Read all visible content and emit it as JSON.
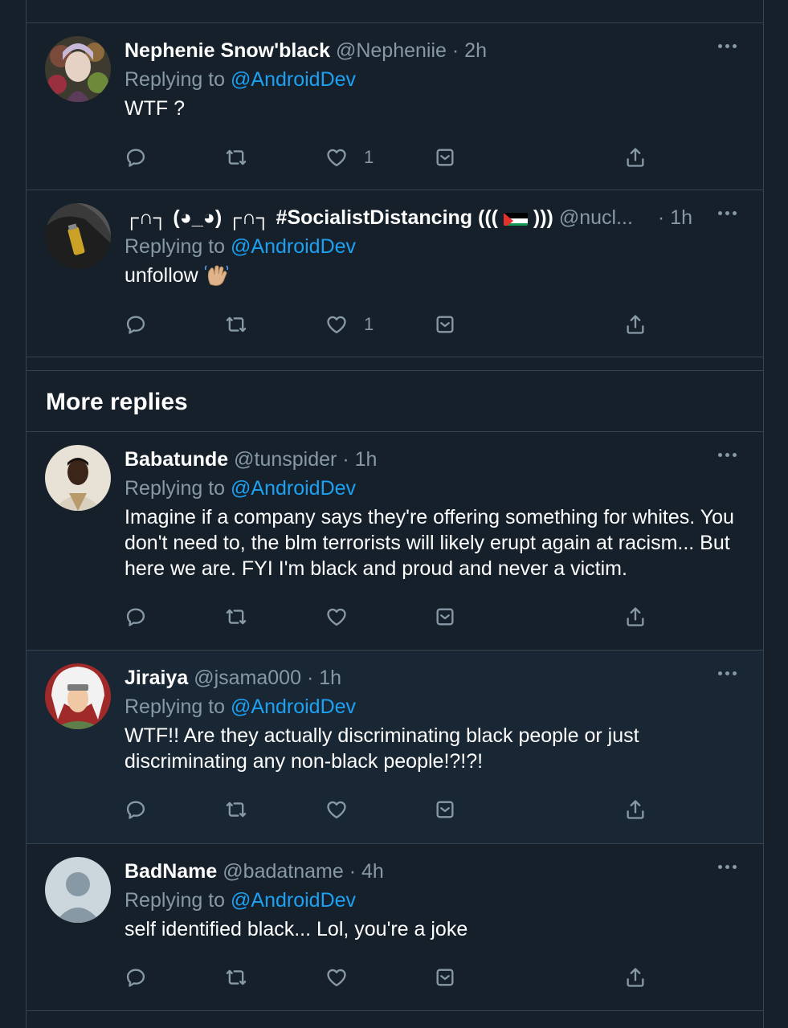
{
  "colors": {
    "background": "#15202b",
    "border": "#38444d",
    "secondary_text": "#8899a6",
    "link": "#1da1f2"
  },
  "section_title": "More replies",
  "reply_prefix": "Replying to",
  "reply_target": "@AndroidDev",
  "tweets": [
    {
      "name": "Nephenie Snow'black",
      "handle": "@Nepheniie",
      "time": "2h",
      "text": "WTF ?",
      "likes": "1"
    },
    {
      "name_prefix": "┌∩┐ (◕_◕) ┌∩┐ #SocialistDistancing (((",
      "name_suffix": ")))",
      "handle": "@nucl...",
      "time": "1h",
      "text": "unfollow",
      "likes": "1"
    },
    {
      "name": "Babatunde",
      "handle": "@tunspider",
      "time": "1h",
      "text_lines": [
        "Imagine if a company says they're offering something for whites. You",
        "don't need to, the blm terrorists will likely erupt again at racism... But",
        "here we are. FYI I'm black and proud and never a victim."
      ],
      "likes": ""
    },
    {
      "name": "Jiraiya",
      "handle": "@jsama000",
      "time": "1h",
      "text_lines": [
        "WTF!! Are they actually discriminating black people or just",
        "discriminating any non-black people!?!?!"
      ],
      "likes": ""
    },
    {
      "name": "BadName",
      "handle": "@badatname",
      "time": "4h",
      "text": "self identified black... Lol, you're a joke",
      "likes": ""
    }
  ],
  "icons": [
    "reply-icon",
    "retweet-icon",
    "like-icon",
    "messages-icon",
    "share-icon",
    "more-icon"
  ]
}
